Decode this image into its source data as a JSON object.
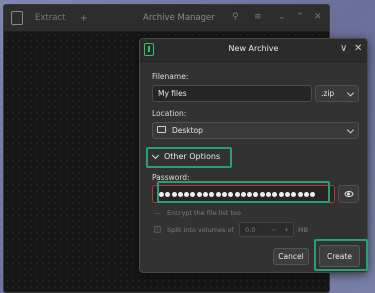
{
  "background_window": {
    "extract_label": "Extract",
    "add_label": "+",
    "title": "Archive Manager",
    "search_glyph": "⚲",
    "menu_glyph": "≡",
    "minimize_glyph": "⌄",
    "maximize_glyph": "⌃",
    "close_glyph": "✕"
  },
  "dialog": {
    "title": "New Archive",
    "minimize_glyph": "∨",
    "close_glyph": "✕",
    "filename_label": "Filename:",
    "filename_value": "My files",
    "extension_value": ".zip",
    "location_label": "Location:",
    "location_value": "Desktop",
    "other_options_label": "Other Options",
    "password_label": "Password:",
    "password_dot_count": 25,
    "encrypt_label": "Encrypt the file list too",
    "split_label": "Split into volumes of",
    "split_value": "0,0",
    "split_minus": "−",
    "split_plus": "+",
    "split_unit": "MB",
    "cancel_label": "Cancel",
    "create_label": "Create"
  },
  "colors": {
    "highlight": "#2a9d7a",
    "accent_green": "#3fbf6a",
    "password_error_border": "#b03a3a"
  },
  "icons": {
    "app_logo": "archive-icon",
    "location_icon": "desktop-icon",
    "eye_icon": "eye-icon"
  }
}
